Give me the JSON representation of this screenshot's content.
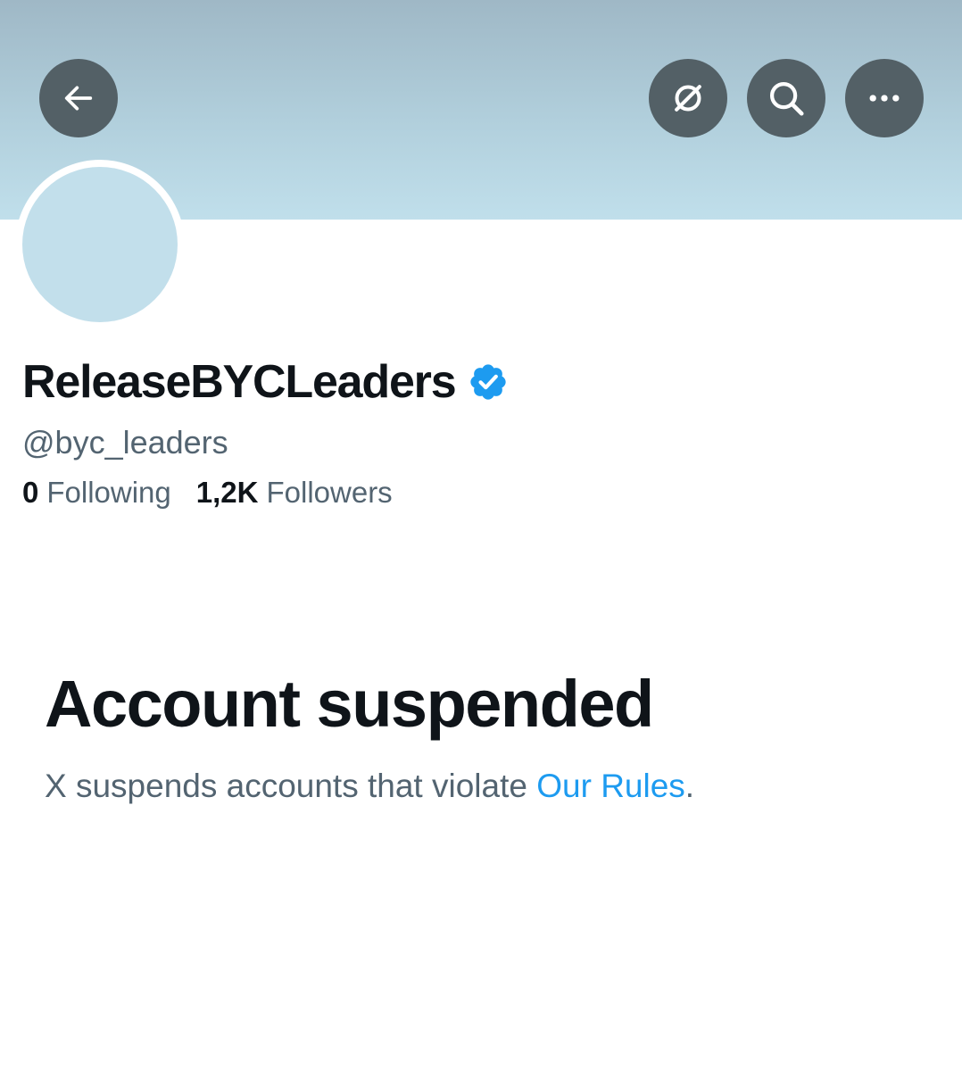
{
  "header": {
    "back_icon": "arrow-left-icon",
    "grok_icon": "grok-slash-icon",
    "search_icon": "search-icon",
    "more_icon": "more-horizontal-icon",
    "button_color": "#536066"
  },
  "profile": {
    "display_name": "ReleaseBYCLeaders",
    "verified_icon": "verified-badge-icon",
    "verified_color": "#1d9bf0",
    "handle": "@byc_leaders",
    "following_count": "0",
    "following_label": "Following",
    "followers_count": "1,2K",
    "followers_label": "Followers"
  },
  "suspension": {
    "title": "Account suspended",
    "message_prefix": "X suspends accounts that violate ",
    "rules_link": "Our Rules",
    "message_suffix": ".",
    "link_color": "#1d9bf0"
  },
  "colors": {
    "text_primary": "#0f1419",
    "text_secondary": "#536471",
    "avatar_placeholder": "#c2dfeb"
  }
}
